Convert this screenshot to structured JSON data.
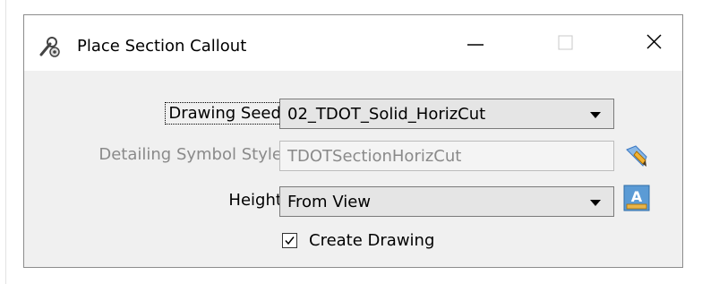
{
  "window": {
    "title": "Place Section Callout",
    "title_icon": "tools-gear-icon",
    "controls": [
      "minimize-icon",
      "maximize-icon",
      "close-icon"
    ]
  },
  "form": {
    "drawing_seed": {
      "label": "Drawing Seed:",
      "value": "02_TDOT_Solid_HorizCut"
    },
    "detailing_symbol_style": {
      "label": "Detailing Symbol Style:",
      "value": "TDOTSectionHorizCut",
      "disabled": true,
      "icon": "pencil-eraser-icon"
    },
    "height": {
      "label": "Height:",
      "value": "From View",
      "icon": "text-height-icon"
    },
    "create_drawing": {
      "label": "Create Drawing",
      "checked": true
    }
  },
  "colors": {
    "dialog_bg": "#f0f0f0",
    "titlebar_bg": "#ffffff",
    "disabled_text": "#8a8a8a",
    "accent_blue": "#3b78c4"
  }
}
